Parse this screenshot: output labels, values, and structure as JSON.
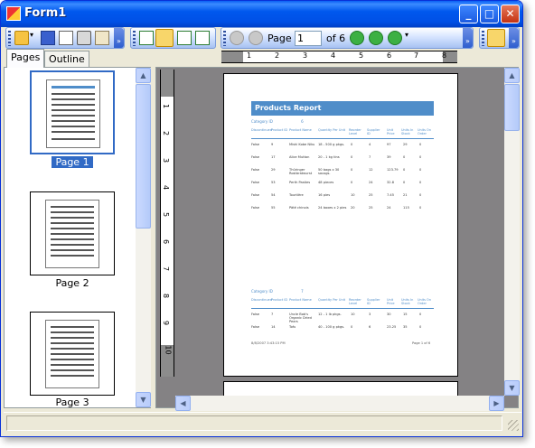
{
  "window": {
    "title": "Form1"
  },
  "toolbar": {
    "page_label": "Page",
    "page_value": "1",
    "of_label": "of 6"
  },
  "tabs": [
    {
      "label": "Pages"
    },
    {
      "label": "Outline"
    }
  ],
  "thumbnails": [
    {
      "label": "Page 1"
    },
    {
      "label": "Page 2"
    },
    {
      "label": "Page 3"
    }
  ],
  "ruler": {
    "h_numbers": [
      "1",
      "2",
      "3",
      "4",
      "5",
      "6",
      "7",
      "8"
    ],
    "v_numbers": [
      "1",
      "2",
      "3",
      "4",
      "5",
      "6",
      "7",
      "8",
      "9",
      "10"
    ]
  },
  "report": {
    "title": "Products Report",
    "section1_label": "Category ID",
    "section1_value": "6",
    "section2_label": "Category ID",
    "section2_value": "7",
    "headers": [
      "Discontinued",
      "Product ID",
      "Product Name",
      "Quantity Per Unit",
      "Reorder Level",
      "Supplier ID",
      "Unit Price",
      "Units In Stock",
      "Units On Order"
    ],
    "rows1": [
      [
        "False",
        "9",
        "Mishi Kobe Niku",
        "18 - 500 g pkgs.",
        "0",
        "4",
        "97",
        "29",
        "0"
      ],
      [
        "False",
        "17",
        "Alice Mutton",
        "20 - 1 kg tins",
        "0",
        "7",
        "39",
        "0",
        "0"
      ],
      [
        "False",
        "29",
        "Thüringer Rostbratwurst",
        "50 bags x 30 sausgs.",
        "0",
        "12",
        "123.79",
        "0",
        "0"
      ],
      [
        "False",
        "53",
        "Perth Pasties",
        "48 pieces",
        "0",
        "24",
        "32.8",
        "0",
        "0"
      ],
      [
        "False",
        "54",
        "Tourtière",
        "16 pies",
        "10",
        "25",
        "7.45",
        "21",
        "0"
      ],
      [
        "False",
        "55",
        "Pâté chinois",
        "24 boxes x 2 pies",
        "20",
        "25",
        "24",
        "115",
        "0"
      ]
    ],
    "rows2": [
      [
        "False",
        "7",
        "Uncle Bob's Organic Dried Pears",
        "12 - 1 lb pkgs.",
        "10",
        "3",
        "30",
        "15",
        "0"
      ],
      [
        "False",
        "14",
        "Tofu",
        "40 - 100 g pkgs.",
        "0",
        "6",
        "23.25",
        "35",
        "0"
      ]
    ],
    "footer_left": "8/8/2007 3:43:15 PM",
    "footer_right": "Page 1 of 6"
  }
}
